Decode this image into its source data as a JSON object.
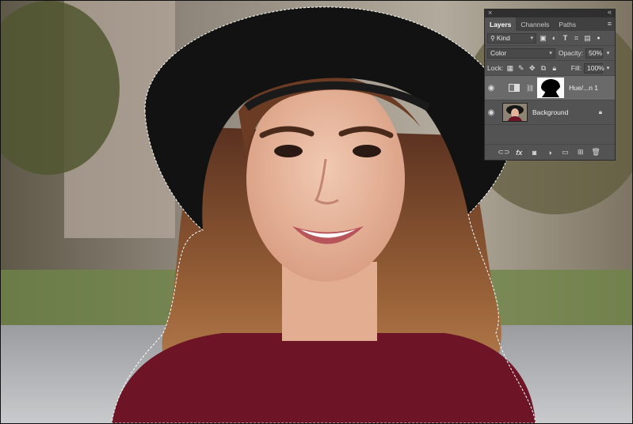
{
  "panel": {
    "close_glyph": "×",
    "collapse_glyph": "«",
    "tabs": [
      {
        "label": "Layers",
        "active": true
      },
      {
        "label": "Channels",
        "active": false
      },
      {
        "label": "Paths",
        "active": false
      }
    ],
    "menu_icon": "panel-menu-icon",
    "filter": {
      "label": "Kind",
      "icons": [
        "pixel-filter-icon",
        "adjustment-filter-icon",
        "type-filter-icon",
        "shape-filter-icon",
        "smart-object-filter-icon",
        "filter-toggle-icon"
      ]
    },
    "blend_mode": "Color",
    "opacity_label": "Opacity:",
    "opacity_value": "50%",
    "lock_label": "Lock:",
    "fill_label": "Fill:",
    "fill_value": "100%",
    "layers": [
      {
        "name": "Hue/...n 1",
        "type": "adjustment",
        "visible": true,
        "selected": true
      },
      {
        "name": "Background",
        "type": "image",
        "visible": true,
        "selected": false,
        "locked": true
      }
    ],
    "bottom_icons": [
      "link-layers-icon",
      "fx-icon",
      "add-mask-icon",
      "new-adjustment-icon",
      "new-group-icon",
      "new-layer-icon",
      "delete-layer-icon"
    ],
    "fx_label": "fx"
  },
  "colors": {
    "panel_bg": "#535353",
    "tab_bar": "#404040",
    "selected_layer": "#6a6a6a",
    "hat": "#121212",
    "sweater": "#6d1527",
    "hair": "#8a5533"
  }
}
